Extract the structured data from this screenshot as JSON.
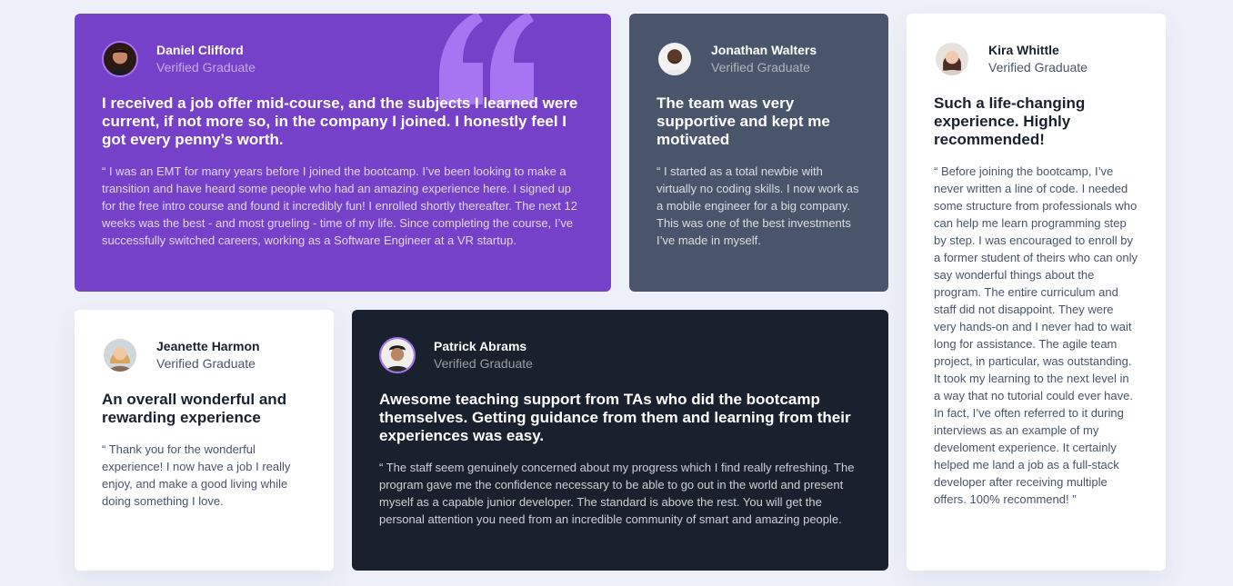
{
  "testimonials": [
    {
      "name": "Daniel Clifford",
      "role": "Verified Graduate",
      "headline": "I received a job offer mid-course, and the subjects I learned were current, if not more so, in the company I joined. I honestly feel I got every penny’s worth.",
      "body": "“ I was an EMT for many years before I joined the bootcamp. I’ve been looking to make a transition and have heard some people who had an amazing experience here. I signed up for the free intro course and found it incredibly fun! I enrolled shortly thereafter. The next 12 weeks was the best - and most grueling - time of my life. Since completing the course, I’ve successfully switched careers, working as a Software Engineer at a VR startup.",
      "background": "#7541c8",
      "avatar_icon": "avatar-daniel-icon"
    },
    {
      "name": "Jonathan Walters",
      "role": "Verified Graduate",
      "headline": "The team was very supportive and kept me motivated",
      "body": "“ I started as a total newbie with virtually no coding skills. I now work as a mobile engineer for a big company. This was one of the best investments I’ve made in myself.",
      "background": "#48556a",
      "avatar_icon": "avatar-jonathan-icon"
    },
    {
      "name": "Kira Whittle",
      "role": "Verified Graduate",
      "headline": "Such a life-changing experience. Highly recommended!",
      "body": "“ Before joining the bootcamp, I’ve never written a line of code. I needed some structure from professionals who can help me learn programming step by step. I was encouraged to enroll by a former student of theirs who can only say wonderful things about the program. The entire curriculum and staff did not disappoint. They were very hands-on and I never had to wait long for assistance. The agile team project, in particular, was outstanding. It took my learning to the next level in a way that no tutorial could ever have. In fact, I’ve often referred to it during interviews as an example of my develoment experience. It certainly helped me land a job as a full-stack developer after receiving multiple offers. 100% recommend! ”",
      "background": "#ffffff",
      "avatar_icon": "avatar-kira-icon"
    },
    {
      "name": "Jeanette Harmon",
      "role": "Verified Graduate",
      "headline": "An overall wonderful and rewarding experience",
      "body": "“ Thank you for the wonderful experience! I now have a job I really enjoy, and make a good living while doing something I love.",
      "background": "#ffffff",
      "avatar_icon": "avatar-jeanette-icon"
    },
    {
      "name": "Patrick Abrams",
      "role": "Verified Graduate",
      "headline": "Awesome teaching support from TAs who did the bootcamp themselves. Getting guidance from them and learning from their experiences was easy.",
      "body": "“ The staff seem genuinely concerned about my progress which I find really refreshing. The program gave me the confidence necessary to be able to go out in the world and present myself as a capable junior developer. The standard is above the rest. You will get the personal attention you need from an incredible community of smart and amazing people.",
      "background": "#19212e",
      "avatar_icon": "avatar-patrick-icon"
    }
  ],
  "colors": {
    "page_background": "#edf0f8",
    "purple": "#7541c8",
    "slate": "#48556a",
    "dark": "#19212e",
    "quote_mark": "#a775f1"
  },
  "decoration": {
    "quote_icon": "quotation-mark-icon"
  }
}
